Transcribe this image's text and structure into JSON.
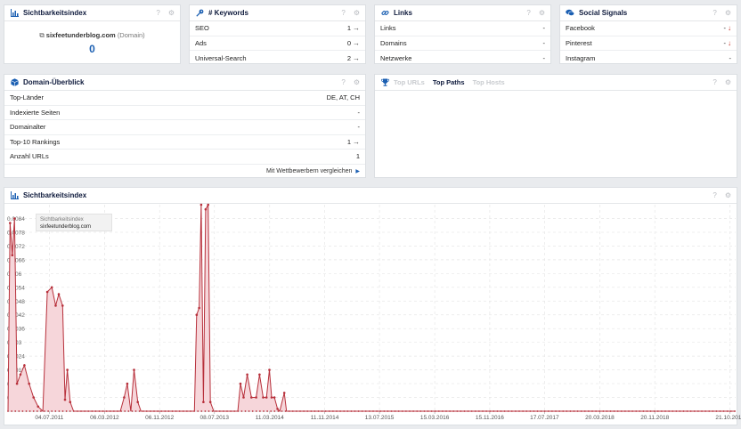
{
  "sichtbarkeit_panel": {
    "title": "Sichtbarkeitsindex",
    "domain": "sixfeetunderblog.com",
    "domain_suffix": "(Domain)",
    "value": "0"
  },
  "keywords_panel": {
    "title": "# Keywords",
    "rows": [
      {
        "label": "SEO",
        "value": "1"
      },
      {
        "label": "Ads",
        "value": "0"
      },
      {
        "label": "Universal-Search",
        "value": "2"
      }
    ]
  },
  "links_panel": {
    "title": "Links",
    "rows": [
      {
        "label": "Links",
        "value": "-"
      },
      {
        "label": "Domains",
        "value": "-"
      },
      {
        "label": "Netzwerke",
        "value": "-"
      }
    ]
  },
  "social_panel": {
    "title": "Social Signals",
    "rows": [
      {
        "label": "Facebook",
        "value": "-"
      },
      {
        "label": "Pinterest",
        "value": "-"
      },
      {
        "label": "Instagram",
        "value": "-"
      }
    ]
  },
  "overview_panel": {
    "title": "Domain-Überblick",
    "rows": [
      {
        "label": "Top-Länder",
        "value": "DE, AT, CH"
      },
      {
        "label": "Indexierte Seiten",
        "value": "-"
      },
      {
        "label": "Domainalter",
        "value": "-"
      },
      {
        "label": "Top-10 Rankings",
        "value": "1"
      },
      {
        "label": "Anzahl URLs",
        "value": "1"
      }
    ],
    "compare_link": "Mit Wettbewerbern vergleichen"
  },
  "top_panel": {
    "tabs": [
      "Top URLs",
      "Top Paths",
      "Top Hosts"
    ],
    "active_tab": "Top Paths"
  },
  "chart_panel": {
    "title": "Sichtbarkeitsindex",
    "tooltip_line1": "Sichtbarkeitsindex",
    "tooltip_line2": "sixfeetunderblog.com"
  },
  "chart_data": {
    "type": "area",
    "title": "Sichtbarkeitsindex",
    "series": [
      {
        "name": "sixfeetunderblog.com",
        "color": "#b7303b",
        "fill": "#f6d6da"
      }
    ],
    "ylim": [
      0,
      0.0009
    ],
    "y_ticks": [
      "0.0006",
      "0.0012",
      "0.0018",
      "0.0024",
      "0.003",
      "0.0036",
      "0.0042",
      "0.0048",
      "0.0054",
      "0.006",
      "0.0066",
      "0.0072",
      "0.0078",
      "0.0084"
    ],
    "y_tick_values": [
      6e-05,
      0.00012,
      0.00018,
      0.00024,
      0.0003,
      0.00036,
      0.00042,
      0.00048,
      0.00054,
      0.0006,
      0.00066,
      0.00072,
      0.00078,
      0.00084
    ],
    "x_ticks": [
      "04.07.2011",
      "06.03.2012",
      "06.11.2012",
      "08.07.2013",
      "11.03.2014",
      "11.11.2014",
      "13.07.2015",
      "15.03.2016",
      "15.11.2016",
      "17.07.2017",
      "20.03.2018",
      "20.11.2018",
      "21.10.2019"
    ],
    "points": [
      [
        "2011-01-01",
        0
      ],
      [
        "2011-01-10",
        0.00082
      ],
      [
        "2011-01-20",
        0.00068
      ],
      [
        "2011-01-30",
        0.00084
      ],
      [
        "2011-02-10",
        0.00012
      ],
      [
        "2011-02-25",
        0.00016
      ],
      [
        "2011-03-15",
        0.0002
      ],
      [
        "2011-04-05",
        0.00012
      ],
      [
        "2011-04-25",
        6e-05
      ],
      [
        "2011-05-15",
        2e-05
      ],
      [
        "2011-06-05",
        0
      ],
      [
        "2011-06-25",
        0.00052
      ],
      [
        "2011-07-15",
        0.00054
      ],
      [
        "2011-08-01",
        0.00046
      ],
      [
        "2011-08-15",
        0.00051
      ],
      [
        "2011-09-01",
        0.00046
      ],
      [
        "2011-09-12",
        5e-05
      ],
      [
        "2011-09-22",
        0.00018
      ],
      [
        "2011-10-05",
        4e-05
      ],
      [
        "2011-10-20",
        0
      ],
      [
        "2012-05-15",
        0
      ],
      [
        "2012-06-01",
        6e-05
      ],
      [
        "2012-06-15",
        0.00012
      ],
      [
        "2012-07-01",
        0
      ],
      [
        "2012-07-15",
        0.00018
      ],
      [
        "2012-08-01",
        4e-05
      ],
      [
        "2012-08-15",
        0
      ],
      [
        "2013-04-10",
        0
      ],
      [
        "2013-04-20",
        0.00042
      ],
      [
        "2013-05-01",
        0.00045
      ],
      [
        "2013-05-10",
        0.0009
      ],
      [
        "2013-05-20",
        4e-05
      ],
      [
        "2013-05-30",
        0.00088
      ],
      [
        "2013-06-10",
        0.0009
      ],
      [
        "2013-06-20",
        4e-05
      ],
      [
        "2013-07-05",
        0
      ],
      [
        "2013-10-20",
        0
      ],
      [
        "2013-11-01",
        0.00012
      ],
      [
        "2013-11-15",
        6e-05
      ],
      [
        "2013-12-01",
        0.00016
      ],
      [
        "2013-12-20",
        6e-05
      ],
      [
        "2014-01-10",
        6e-05
      ],
      [
        "2014-01-25",
        0.00016
      ],
      [
        "2014-02-10",
        6e-05
      ],
      [
        "2014-02-25",
        6e-05
      ],
      [
        "2014-03-10",
        0.00018
      ],
      [
        "2014-03-20",
        6e-05
      ],
      [
        "2014-04-01",
        6e-05
      ],
      [
        "2014-04-15",
        1e-05
      ],
      [
        "2014-04-25",
        0
      ],
      [
        "2014-05-15",
        8e-05
      ],
      [
        "2014-05-25",
        0
      ],
      [
        "2019-11-15",
        0
      ]
    ]
  }
}
